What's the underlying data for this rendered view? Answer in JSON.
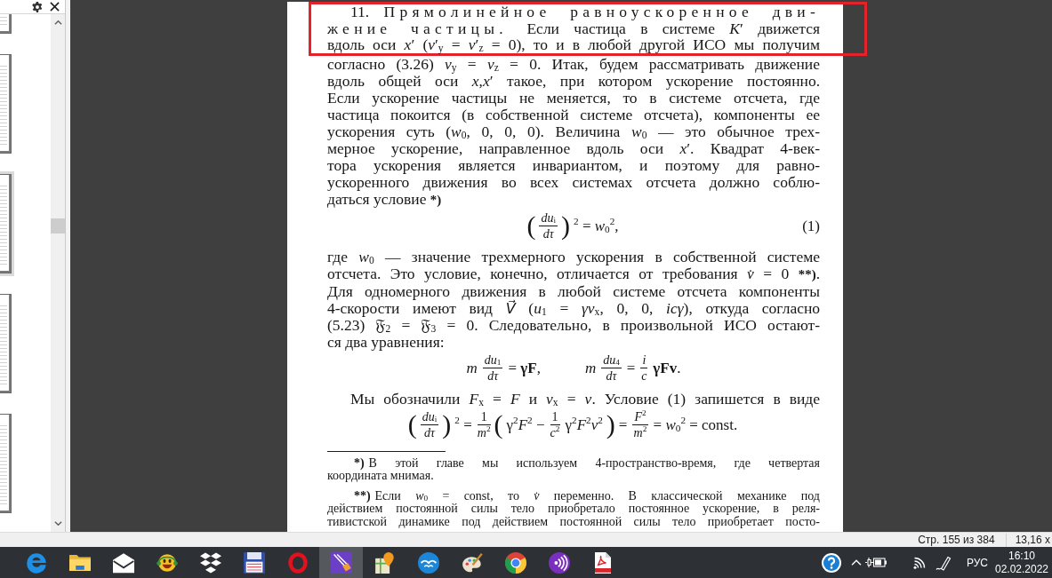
{
  "sidebar": {
    "thumbnails": [
      {
        "selected": false
      },
      {
        "selected": false
      },
      {
        "selected": true
      },
      {
        "selected": false
      },
      {
        "selected": false
      }
    ]
  },
  "page": {
    "blocks": [
      {
        "kind": "highlight",
        "content": {
          "indent": true,
          "last_line_short": false,
          "lines": [
            {
              "runs": [
                {
                  "kind": "plain",
                  "text": "11. "
                },
                {
                  "kind": "spaced",
                  "text": "Прямолинейное равноускоренное дви-"
                }
              ]
            },
            {
              "runs": [
                {
                  "kind": "spaced",
                  "text": "жение частицы. "
                },
                {
                  "kind": "plain",
                  "text": "Если частица в системе *K*′ движется"
                }
              ]
            },
            "вдоль оси *x*′ (*v*′$_{y}$ = *v*′$_{z}$ = 0), то и в любой другой ИСО мы получим"
          ]
        }
      },
      {
        "kind": "paragraph",
        "indent": false,
        "last_line_short": true,
        "lines": [
          "согласно (3.26) *v*$_{y}$ = *v*$_{z}$ = 0. Итак, будем рассматривать движение",
          "вдоль общей оси *x*,*x*′ такое, при котором ускорение постоянно.",
          "Если ускорение частицы не меняется, то в системе отсчета, где",
          "частица покоится (в собственной системе отсчета), компоненты ее",
          "ускорения суть (*w*$_{0}$, 0, 0, 0). Величина *w*$_{0}$ — это обычное трех-",
          "мерное ускорение, направленное вдоль оси *x*′. Квадрат 4-век-",
          "тора ускорения является инвариантом, и поэтому для равно-",
          "ускоренного движения во всех системах отсчета должно соблю-",
          {
            "runs": [
              {
                "kind": "plain",
                "text": "даться условие "
              },
              {
                "kind": "mark",
                "text": "*)"
              }
            ]
          }
        ]
      },
      {
        "kind": "equation",
        "number": "(1)",
        "groups": [
          [
            {
              "kind": "paren",
              "text": "("
            },
            {
              "kind": "frac",
              "num": "*du*$_{i}$",
              "den": "*dτ*"
            },
            {
              "kind": "paren",
              "text": ")"
            },
            {
              "kind": "text",
              "text": "$^{2}$ = *w*$_{0}$$^{2}$,"
            }
          ]
        ]
      },
      {
        "kind": "paragraph",
        "indent": false,
        "last_line_short": true,
        "lines": [
          "где *w*$_{0}$ — значение трехмерного ускорения в собственной системе",
          {
            "runs": [
              {
                "kind": "plain",
                "text": "отсчета. Это условие, конечно, отличается от требования *v̇* = 0 "
              },
              {
                "kind": "mark",
                "text": "**)"
              },
              {
                "kind": "plain",
                "text": "."
              }
            ]
          },
          "Для одномерного движения в любой системе отсчета компоненты",
          {
            "runs": [
              {
                "kind": "plain",
                "text": "4-скорости имеют вид "
              },
              {
                "kind": "vector",
                "text": "V⃗"
              },
              {
                "kind": "plain",
                "text": " (*u*$_{1}$ = *γv*$_{x}$, 0, 0, *icγ*), откуда согласно"
              }
            ]
          },
          "(5.23) 𝔉$_{2}$ = 𝔉$_{3}$ = 0. Следовательно, в произвольной ИСО остают-",
          "ся два уравнения:"
        ]
      },
      {
        "kind": "equation",
        "groups": [
          [
            {
              "kind": "text",
              "text": "*m*"
            },
            {
              "kind": "frac",
              "num": "*du*$_{1}$",
              "den": "*dτ*"
            },
            {
              "kind": "text",
              "text": "= **γF**,"
            }
          ],
          [
            {
              "kind": "text",
              "text": "*m*"
            },
            {
              "kind": "frac",
              "num": "*du*$_{4}$",
              "den": "*dτ*"
            },
            {
              "kind": "text",
              "text": "="
            },
            {
              "kind": "frac",
              "num": "*i*",
              "den": "*c*"
            },
            {
              "kind": "text",
              "text": "**γFv**."
            }
          ]
        ]
      },
      {
        "kind": "paragraph",
        "indent": true,
        "last_line_short": false,
        "lines": [
          "Мы обозначили *F*$_{x}$ = *F* и *v*$_{x}$ = *v*. Условие (1) запишется в виде"
        ]
      },
      {
        "kind": "equation",
        "groups": [
          [
            {
              "kind": "paren",
              "text": "("
            },
            {
              "kind": "frac",
              "num": "*du*$_{i}$",
              "den": "*dτ*"
            },
            {
              "kind": "paren",
              "text": ")"
            },
            {
              "kind": "text",
              "text": "$^{2}$ ="
            },
            {
              "kind": "frac",
              "num": "1",
              "den": "*m*$^{2}$"
            },
            {
              "kind": "paren",
              "text": "("
            },
            {
              "kind": "text",
              "text": "γ$^{2}$*F*$^{2}$ −"
            },
            {
              "kind": "frac",
              "num": "1",
              "den": "*c*$^{2}$"
            },
            {
              "kind": "text",
              "text": "γ$^{2}$*F*$^{2}$*v*$^{2}$"
            },
            {
              "kind": "paren",
              "text": ")"
            },
            {
              "kind": "text",
              "text": "="
            },
            {
              "kind": "frac",
              "num": "*F*$^{2}$",
              "den": "*m*$^{2}$"
            },
            {
              "kind": "text",
              "text": "= *w*$_{0}$$^{2}$ = const."
            }
          ]
        ]
      },
      {
        "kind": "footnote",
        "indent": true,
        "last_line_short": true,
        "mark": "*)",
        "lines": [
          "В этой главе мы используем 4-пространство-время, где четвертая",
          "координата мнимая."
        ]
      },
      {
        "kind": "footnote",
        "indent": true,
        "last_line_short": false,
        "mark": "**)",
        "lines": [
          "Если *w*$_{0}$ = const, то *v̇* переменно. В классической механике под",
          "действием постоянной силы тело приобретало постоянное ускорение, в реля-",
          "тивистской динамике под действием постоянной силы тело приобретает посто-"
        ]
      }
    ]
  },
  "status_bar": {
    "page": "Стр. 155 из 384",
    "page_size": "13,16 x"
  },
  "taskbar": {
    "apps": [
      {
        "kind": "swirl",
        "selected": false
      },
      {
        "kind": "folder",
        "selected": false
      },
      {
        "kind": "mail",
        "selected": false
      },
      {
        "kind": "smiley",
        "selected": false
      },
      {
        "kind": "boxes",
        "selected": false
      },
      {
        "kind": "floppy",
        "selected": false
      },
      {
        "kind": "ring",
        "selected": false
      },
      {
        "kind": "pen",
        "selected": true
      },
      {
        "kind": "map",
        "selected": false
      },
      {
        "kind": "birds",
        "selected": false
      },
      {
        "kind": "palette",
        "selected": false
      },
      {
        "kind": "wheel",
        "selected": false
      },
      {
        "kind": "waves",
        "selected": false
      },
      {
        "kind": "pdf",
        "selected": false
      }
    ],
    "tray": {
      "language": "РУС",
      "time": "16:10",
      "date": "02.02.2022"
    }
  }
}
